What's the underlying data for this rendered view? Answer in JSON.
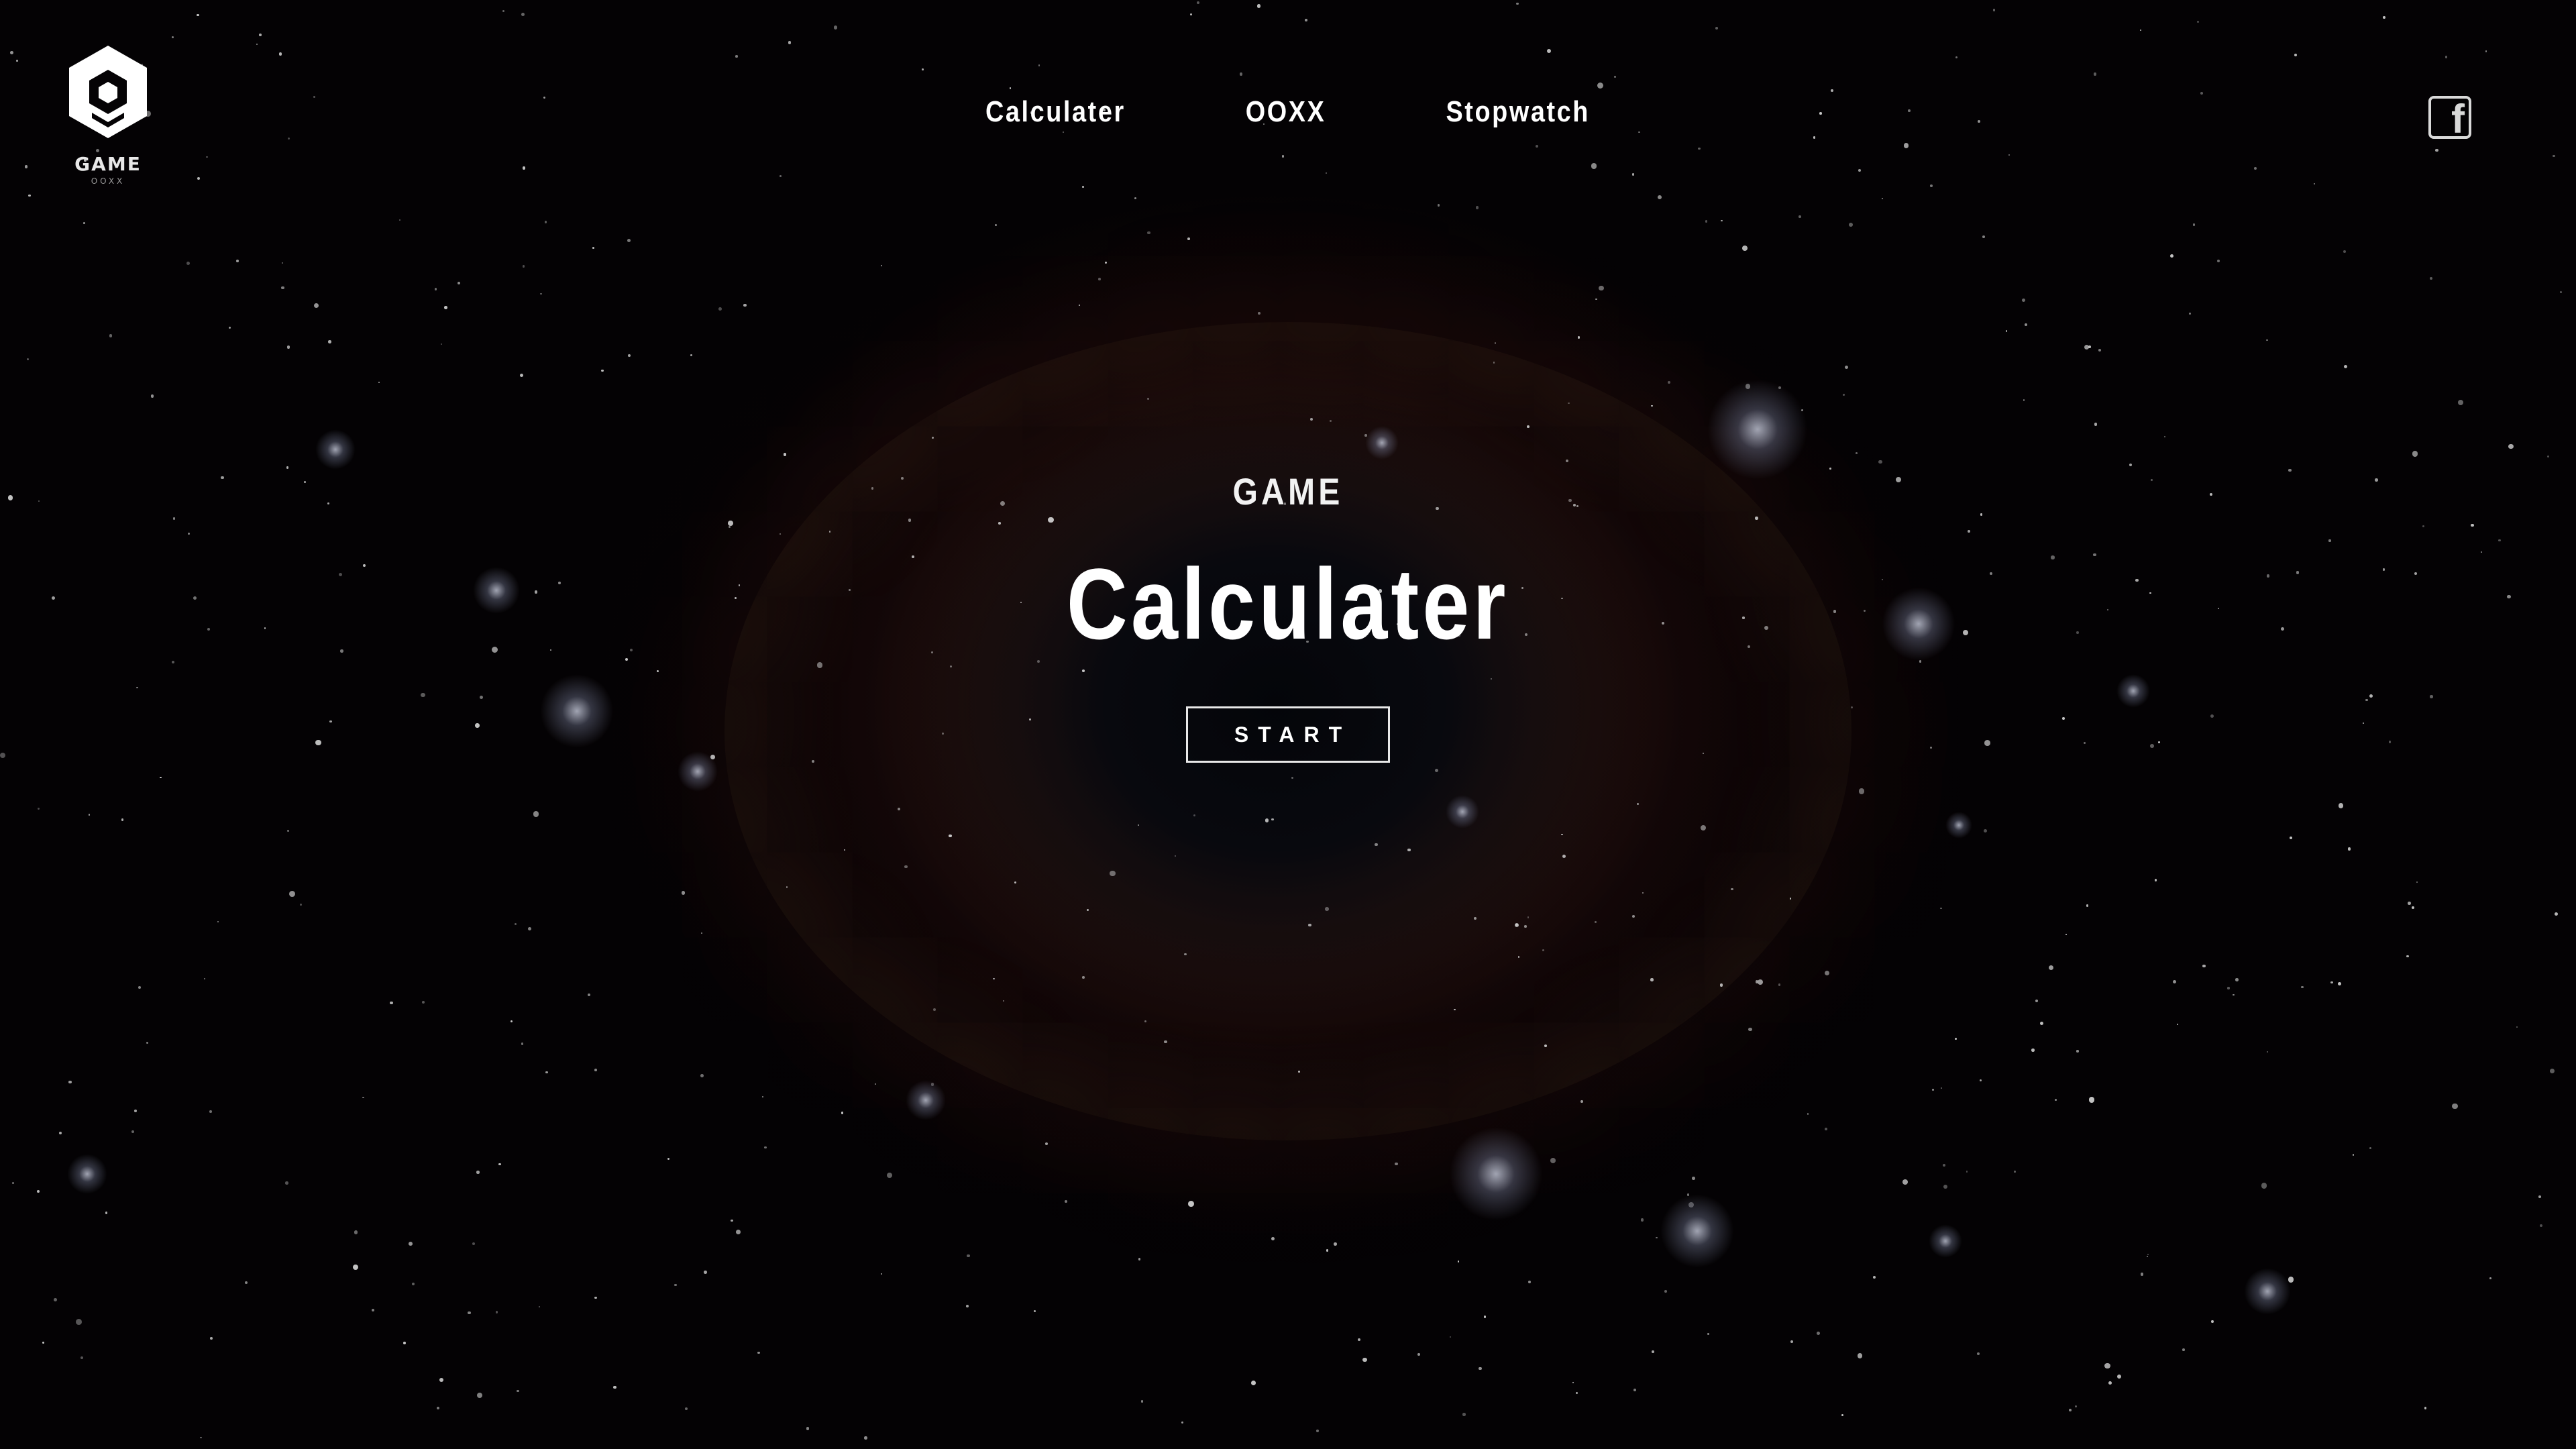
{
  "brand": {
    "logo_icon": "hexagon-logo-icon",
    "name": "GAME",
    "subtitle": "OOXX"
  },
  "nav": {
    "items": [
      {
        "label": "Calculater"
      },
      {
        "label": "OOXX"
      },
      {
        "label": "Stopwatch"
      }
    ]
  },
  "social": {
    "facebook_icon": "facebook-icon",
    "facebook_glyph": "f"
  },
  "hero": {
    "eyebrow": "GAME",
    "title": "Calculater",
    "start_label": "START"
  },
  "colors": {
    "background": "#050305",
    "nebula": "#6e3a28",
    "text": "#ffffff",
    "button_border": "#e8e8e8"
  }
}
